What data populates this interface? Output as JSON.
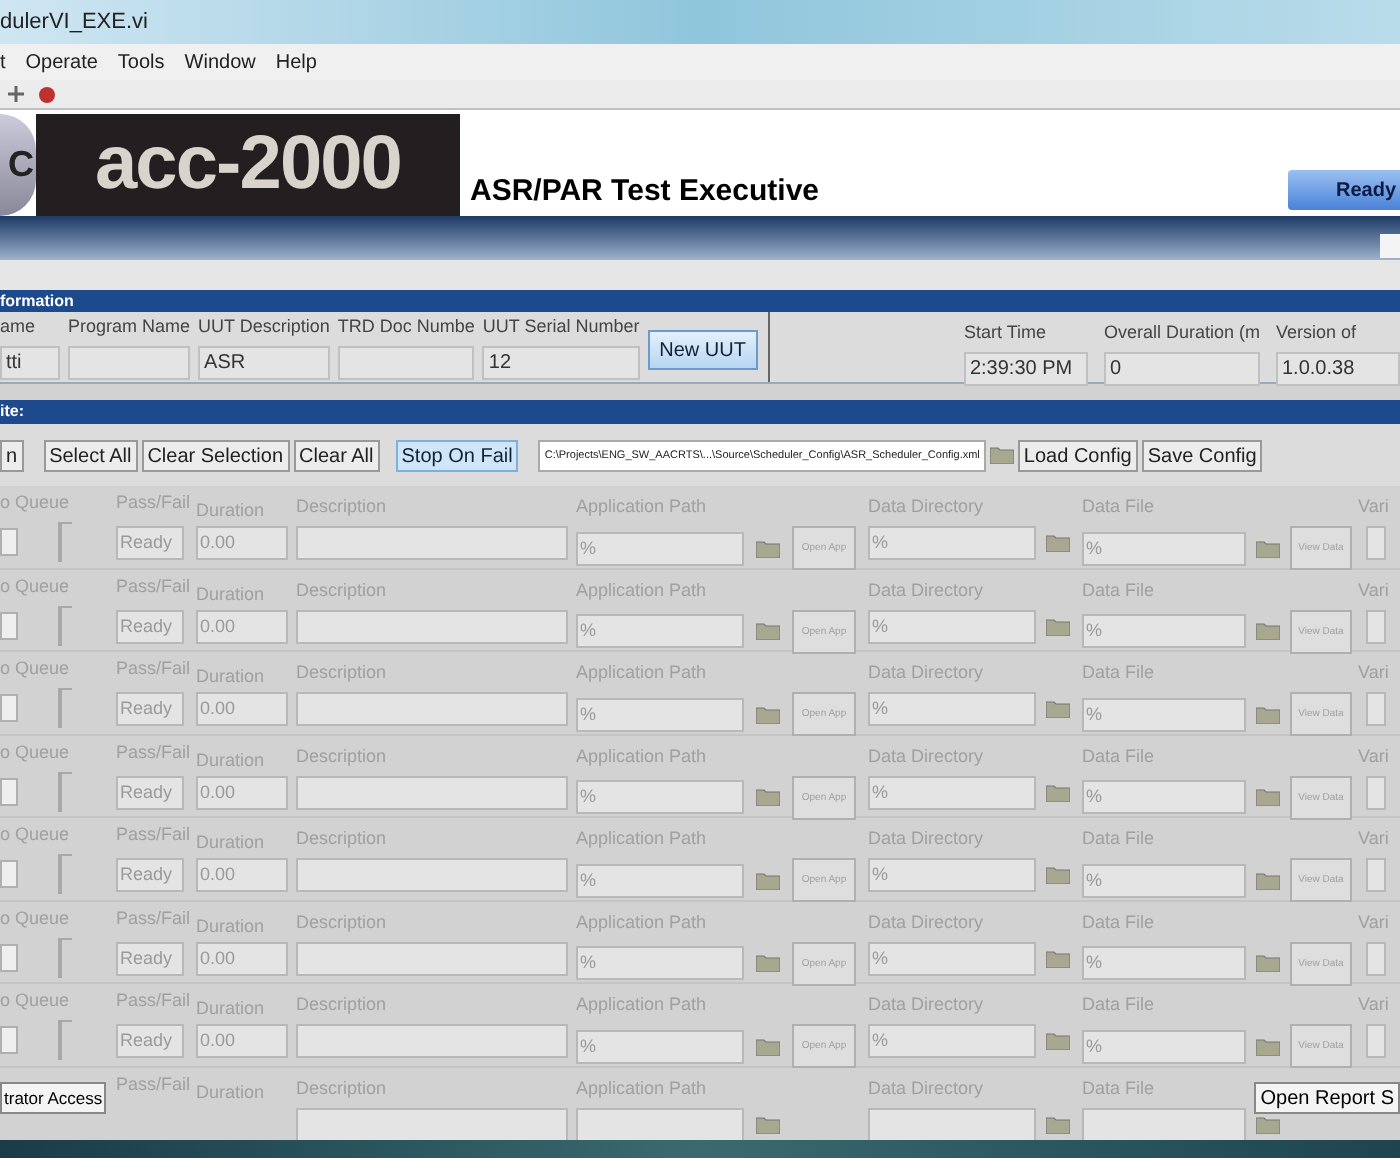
{
  "window": {
    "title": "dulerVI_EXE.vi"
  },
  "menu": [
    {
      "label": "t"
    },
    {
      "label": "Operate"
    },
    {
      "label": "Tools"
    },
    {
      "label": "Window"
    },
    {
      "label": "Help"
    }
  ],
  "banner": {
    "logo_letter": "C",
    "logo": "acc-2000",
    "title": "ASR/PAR Test Executive",
    "status_button": "Ready"
  },
  "info": {
    "header": "formation",
    "fields": [
      {
        "label": "ame",
        "value": "tti"
      },
      {
        "label": "Program Name"
      },
      {
        "label": "UUT Description",
        "value": "ASR"
      },
      {
        "label": "TRD Doc Numbe"
      },
      {
        "label": "UUT Serial Number",
        "value": "12"
      }
    ],
    "button": "New UUT",
    "right_fields": [
      {
        "label": "Start Time",
        "value": "2:39:30 PM"
      },
      {
        "label": "Overall  Duration (m",
        "value": "0"
      },
      {
        "label": "Version of",
        "value": "1.0.0.38"
      }
    ]
  },
  "suite": {
    "header": "ite:",
    "buttons": [
      {
        "label": "n",
        "on": false
      },
      {
        "label": "Select All",
        "on": false
      },
      {
        "label": "Clear Selection",
        "on": false
      },
      {
        "label": "Clear All",
        "on": false
      },
      {
        "label": "Stop On Fail",
        "on": true
      }
    ],
    "config_path": "C:\\Projects\\ENG_SW_AACRTS\\...\\Source\\Scheduler_Config\\ASR_Scheduler_Config.xml",
    "load": "Load Config",
    "save": "Save Config"
  },
  "rows": [
    {
      "queue": "o Queue",
      "checked": false,
      "pf": "Pass/Fail",
      "status": "Ready",
      "dur": "Duration",
      "duration": "0.00",
      "desc": "Description",
      "app": "Application Path",
      "app_path": "%",
      "open": "Open App",
      "dir": "Data Directory",
      "dir_path": "%",
      "file": "Data File",
      "file_path": "%",
      "view": "View Data",
      "vari": "Vari"
    },
    {
      "queue": "o Queue",
      "checked": false,
      "pf": "Pass/Fail",
      "status": "Ready",
      "dur": "Duration",
      "duration": "0.00",
      "desc": "Description",
      "app": "Application Path",
      "app_path": "%",
      "open": "Open App",
      "dir": "Data Directory",
      "dir_path": "%",
      "file": "Data File",
      "file_path": "%",
      "view": "View Data",
      "vari": "Vari"
    },
    {
      "queue": "o Queue",
      "checked": false,
      "pf": "Pass/Fail",
      "status": "Ready",
      "dur": "Duration",
      "duration": "0.00",
      "desc": "Description",
      "app": "Application Path",
      "app_path": "%",
      "open": "Open App",
      "dir": "Data Directory",
      "dir_path": "%",
      "file": "Data File",
      "file_path": "%",
      "view": "View Data",
      "vari": "Vari"
    },
    {
      "queue": "o Queue",
      "checked": false,
      "pf": "Pass/Fail",
      "status": "Ready",
      "dur": "Duration",
      "duration": "0.00",
      "desc": "Description",
      "app": "Application Path",
      "app_path": "%",
      "open": "Open App",
      "dir": "Data Directory",
      "dir_path": "%",
      "file": "Data File",
      "file_path": "%",
      "view": "View Data",
      "vari": "Vari"
    },
    {
      "queue": "o Queue",
      "checked": false,
      "pf": "Pass/Fail",
      "status": "Ready",
      "dur": "Duration",
      "duration": "0.00",
      "desc": "Description",
      "app": "Application Path",
      "app_path": "%",
      "open": "Open App",
      "dir": "Data Directory",
      "dir_path": "%",
      "file": "Data File",
      "file_path": "%",
      "view": "View Data",
      "vari": "Vari"
    },
    {
      "queue": "o Queue",
      "checked": false,
      "pf": "Pass/Fail",
      "status": "Ready",
      "dur": "Duration",
      "duration": "0.00",
      "desc": "Description",
      "app": "Application Path",
      "app_path": "%",
      "open": "Open App",
      "dir": "Data Directory",
      "dir_path": "%",
      "file": "Data File",
      "file_path": "%",
      "view": "View Data",
      "vari": "Vari"
    },
    {
      "queue": "o Queue",
      "checked": false,
      "pf": "Pass/Fail",
      "status": "Ready",
      "dur": "Duration",
      "duration": "0.00",
      "desc": "Description",
      "app": "Application Path",
      "app_path": "%",
      "open": "Open App",
      "dir": "Data Directory",
      "dir_path": "%",
      "file": "Data File",
      "file_path": "%",
      "view": "View Data",
      "vari": "Vari"
    },
    {
      "pf": "Pass/Fail",
      "dur": "Duration",
      "desc": "Description",
      "app": "Application Path",
      "dir": "Data Directory",
      "file": "Data File"
    }
  ],
  "overlay_buttons": [
    {
      "label": "trator Access"
    },
    {
      "label": "Open Report S"
    }
  ]
}
